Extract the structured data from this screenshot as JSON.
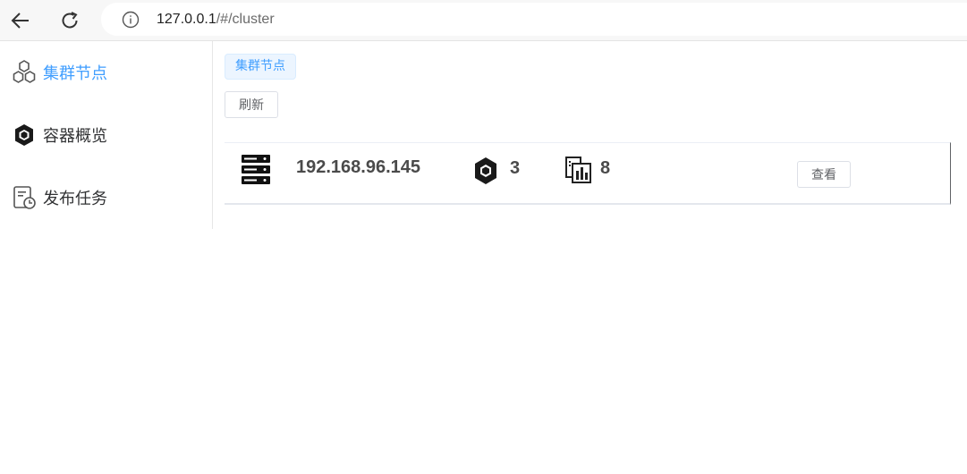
{
  "browser": {
    "url_host": "127.0.0.1",
    "url_path": "/#/cluster",
    "back_icon": "back-arrow-icon",
    "reload_icon": "reload-icon",
    "info_icon": "info-icon"
  },
  "sidebar": {
    "items": [
      {
        "label": "集群节点",
        "icon": "cluster-nodes-icon",
        "active": true
      },
      {
        "label": "容器概览",
        "icon": "container-overview-icon",
        "active": false
      },
      {
        "label": "发布任务",
        "icon": "publish-task-icon",
        "active": false
      }
    ]
  },
  "main": {
    "tag_label": "集群节点",
    "refresh_label": "刷新",
    "nodes": [
      {
        "ip": "192.168.96.145",
        "container_count": "3",
        "image_count": "8",
        "view_label": "查看"
      }
    ]
  },
  "colors": {
    "accent": "#409eff",
    "tag_background": "#ecf5ff",
    "text": "#303133"
  }
}
